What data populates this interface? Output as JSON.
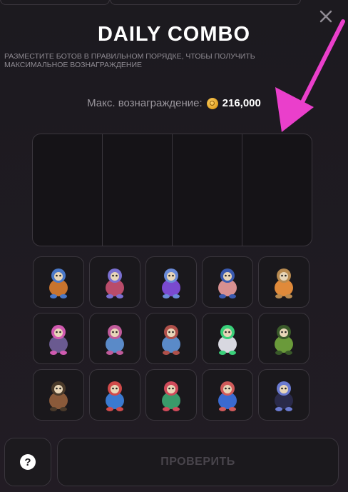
{
  "header": {
    "title": "DAILY COMBO",
    "subtitle": "РАЗМЕСТИТЕ БОТОВ В ПРАВИЛЬНОМ ПОРЯДКЕ, ЧТОБЫ ПОЛУЧИТЬ МАКСИМАЛЬНОЕ ВОЗНАГРАЖДЕНИЕ",
    "close_icon": "close-icon"
  },
  "reward": {
    "label": "Макс. вознаграждение:",
    "value": "216,000",
    "icon": "coin-icon"
  },
  "slots": [
    {
      "slot": 1,
      "content": ""
    },
    {
      "slot": 2,
      "content": ""
    },
    {
      "slot": 3,
      "content": ""
    },
    {
      "slot": 4,
      "content": ""
    }
  ],
  "bots": [
    {
      "icon": "bot-astronaut-orange-icon",
      "color": "#c8742e",
      "accent": "#4a78c8"
    },
    {
      "icon": "bot-astronaut-pink-icon",
      "color": "#b94c6a",
      "accent": "#7a6fd0"
    },
    {
      "icon": "bot-astronaut-purple-icon",
      "color": "#7a4ad0",
      "accent": "#6a8ad8"
    },
    {
      "icon": "bot-hamster-helmet-icon",
      "color": "#d89090",
      "accent": "#3a5ab0"
    },
    {
      "icon": "bot-dog-hat-icon",
      "color": "#e08a3a",
      "accent": "#b88a50"
    },
    {
      "icon": "bot-cat-icon",
      "color": "#6a5a90",
      "accent": "#d05ab0"
    },
    {
      "icon": "bot-cactus-pink-icon",
      "color": "#5a8ac8",
      "accent": "#c05a9a"
    },
    {
      "icon": "bot-cactus-robot-icon",
      "color": "#5a8ac8",
      "accent": "#b0504a"
    },
    {
      "icon": "bot-drone-icon",
      "color": "#d8d8e0",
      "accent": "#3ad07a"
    },
    {
      "icon": "bot-spider-green-icon",
      "color": "#6a9a3a",
      "accent": "#3a5a2a"
    },
    {
      "icon": "bot-spider-brown-icon",
      "color": "#8a5a3a",
      "accent": "#4a3a2a"
    },
    {
      "icon": "bot-penguin-red-icon",
      "color": "#3a7ad0",
      "accent": "#d04a4a"
    },
    {
      "icon": "bot-penguin-green-icon",
      "color": "#3a9a6a",
      "accent": "#d04a5a"
    },
    {
      "icon": "bot-penguin-blue-icon",
      "color": "#3a6ad0",
      "accent": "#d05a5a"
    },
    {
      "icon": "bot-panther-icon",
      "color": "#2a2a4a",
      "accent": "#6a7ad0"
    }
  ],
  "footer": {
    "help_label": "?",
    "check_label": "ПРОВЕРИТЬ"
  },
  "colors": {
    "background": "#1f1b22",
    "border": "#3a363d",
    "arrow": "#ea3fcb",
    "coin": "#e0a020",
    "disabled_text": "#48444b"
  }
}
